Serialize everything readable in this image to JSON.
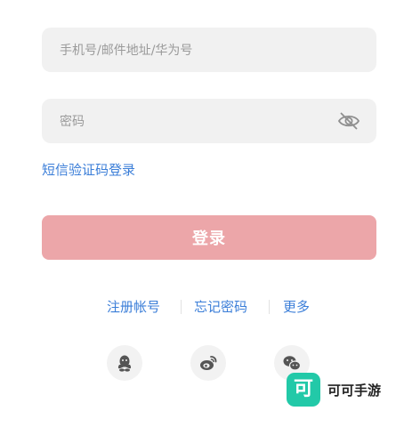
{
  "form": {
    "account_placeholder": "手机号/邮件地址/华为号",
    "password_placeholder": "密码",
    "password_visibility_icon": "eye-off-icon",
    "sms_login_label": "短信验证码登录",
    "login_label": "登录"
  },
  "links": {
    "register": "注册帐号",
    "forgot_password": "忘记密码",
    "more": "更多"
  },
  "social": [
    {
      "icon": "qq-icon"
    },
    {
      "icon": "weibo-icon"
    },
    {
      "icon": "wechat-icon"
    }
  ],
  "watermark": {
    "logo_char": "可",
    "text": "可可手游"
  },
  "colors": {
    "link": "#3b7ed8",
    "login_button": "#eca6a9",
    "field_bg": "#f1f1f1",
    "watermark_logo": "#22c9a8"
  }
}
